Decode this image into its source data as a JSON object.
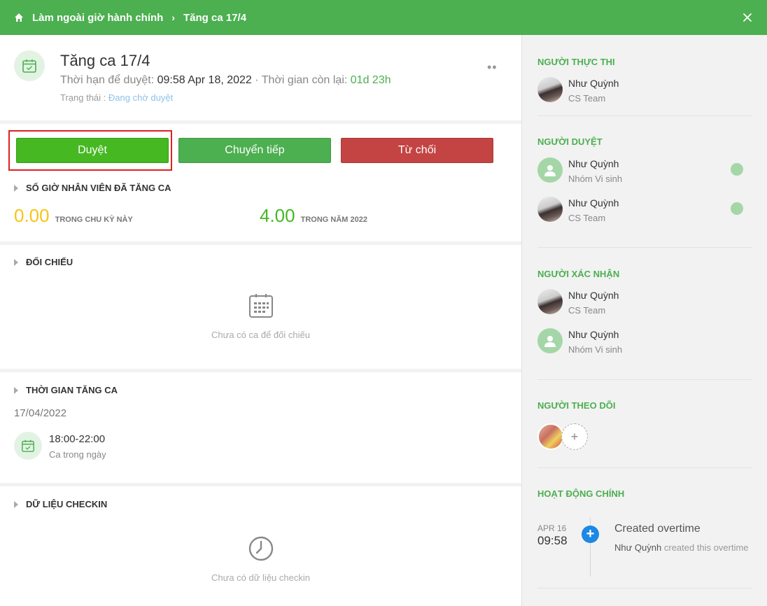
{
  "breadcrumb": {
    "parent": "Làm ngoài giờ hành chính",
    "current": "Tăng ca 17/4"
  },
  "header": {
    "title": "Tăng ca 17/4",
    "deadline_label": "Thời hạn để duyệt:",
    "deadline_value": "09:58 Apr 18, 2022",
    "separator": "·",
    "remaining_label": "Thời gian còn lại:",
    "remaining_value": "01d 23h",
    "status_label": "Trạng thái :",
    "status_value": "Đang chờ duyệt",
    "more_glyph": "••"
  },
  "actions": {
    "approve": "Duyệt",
    "forward": "Chuyển tiếp",
    "reject": "Từ chối"
  },
  "overtime_hours": {
    "title": "SỐ GIỜ NHÂN VIÊN ĐÃ TĂNG CA",
    "cycle_value": "0.00",
    "cycle_label": "TRONG CHU KỲ NÀY",
    "year_value": "4.00",
    "year_label": "TRONG NĂM 2022"
  },
  "reconcile": {
    "title": "ĐỐI CHIẾU",
    "empty_text": "Chưa có ca để đối chiếu"
  },
  "overtime_time": {
    "title": "THỜI GIAN TĂNG CA",
    "date": "17/04/2022",
    "shift_time": "18:00-22:00",
    "shift_type": "Ca trong ngày"
  },
  "checkin": {
    "title": "DỮ LIỆU CHECKIN",
    "empty_text": "Chưa có dữ liệu checkin"
  },
  "sidebar": {
    "executor_title": "NGƯỜI THỰC THI",
    "executors": [
      {
        "name": "Như Quỳnh",
        "team": "CS Team"
      }
    ],
    "approver_title": "NGƯỜI DUYỆT",
    "approvers": [
      {
        "name": "Như Quỳnh",
        "team": "Nhóm Vi sinh"
      },
      {
        "name": "Như Quỳnh",
        "team": "CS Team"
      }
    ],
    "confirmer_title": "NGƯỜI XÁC NHẬN",
    "confirmers": [
      {
        "name": "Như Quỳnh",
        "team": "CS Team"
      },
      {
        "name": "Như Quỳnh",
        "team": "Nhóm Vi sinh"
      }
    ],
    "follower_title": "NGƯỜI THEO DÕI",
    "add_glyph": "+",
    "activity_title": "HOẠT ĐỘNG CHÍNH",
    "activity": {
      "date": "APR 16",
      "time": "09:58",
      "title": "Created overtime",
      "actor": "Như Quỳnh",
      "desc": "created this overtime"
    }
  },
  "colors": {
    "brand_green": "#4caf50",
    "approve": "#46b822",
    "reject": "#c44343",
    "highlight": "#e02020",
    "accent_blue": "#1e88e5"
  }
}
